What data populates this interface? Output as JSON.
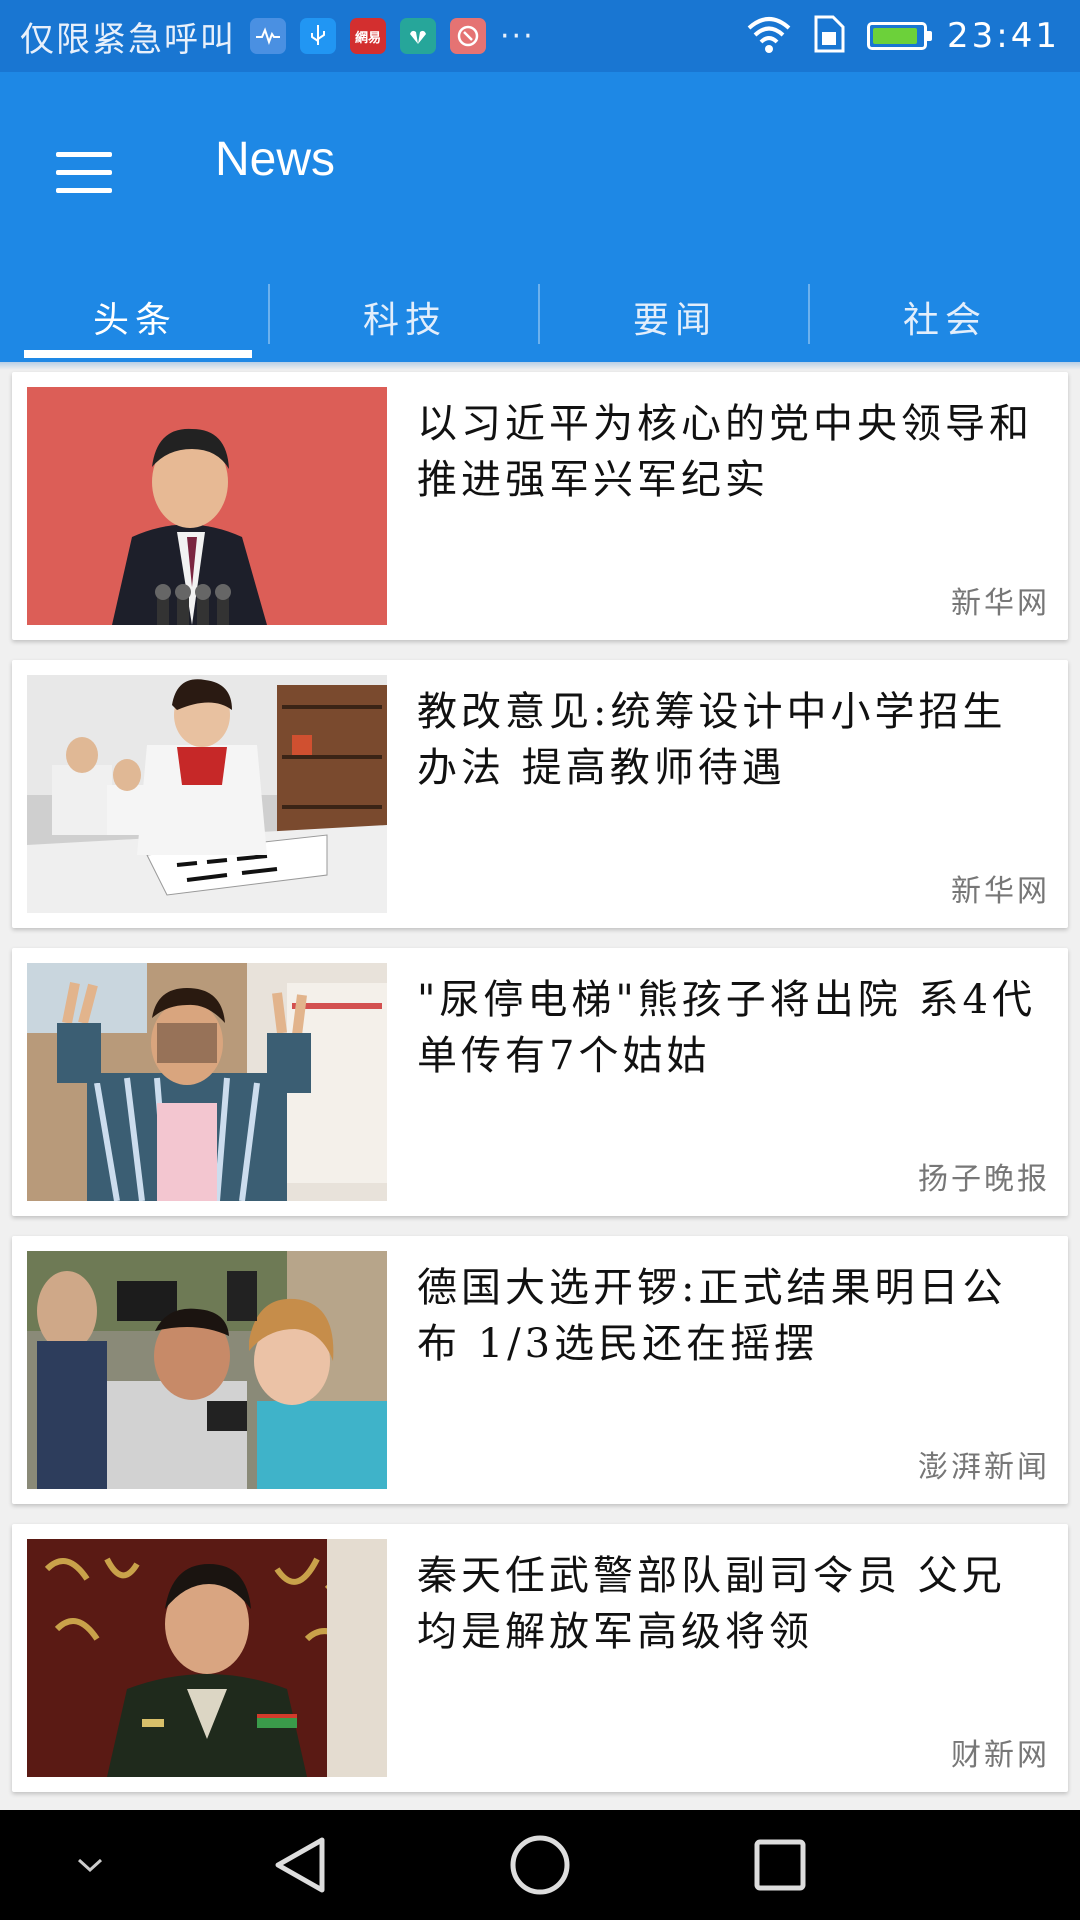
{
  "status_bar": {
    "carrier_text": "仅限紧急呼叫",
    "notification_icons": [
      "health-icon",
      "usb-icon",
      "netease-icon",
      "huawei-icon",
      "gesture-icon"
    ],
    "more": "···",
    "time": "23:41"
  },
  "app_bar": {
    "title": "News",
    "tabs": [
      {
        "label": "头条",
        "active": true
      },
      {
        "label": "科技",
        "active": false
      },
      {
        "label": "要闻",
        "active": false
      },
      {
        "label": "社会",
        "active": false
      }
    ]
  },
  "colors": {
    "status_bar": "#1976d2",
    "app_bar": "#1e88e5",
    "background": "#f0f0f0"
  },
  "articles": [
    {
      "headline": "以习近平为核心的党中央领导和推进强军兴军纪实",
      "source": "新华网",
      "thumbnail": "leader-speaking-photo"
    },
    {
      "headline": "教改意见:统筹设计中小学招生办法 提高教师待遇",
      "source": "新华网",
      "thumbnail": "students-calligraphy-photo"
    },
    {
      "headline": "\"尿停电梯\"熊孩子将出院 系4代单传有7个姑姑",
      "source": "扬子晚报",
      "thumbnail": "child-victory-sign-photo"
    },
    {
      "headline": "德国大选开锣:正式结果明日公布 1/3选民还在摇摆",
      "source": "澎湃新闻",
      "thumbnail": "merkel-selfie-photo"
    },
    {
      "headline": "秦天任武警部队副司令员 父兄均是解放军高级将领",
      "source": "财新网",
      "thumbnail": "officer-portrait-photo"
    }
  ],
  "nav_bar": [
    "collapse-icon",
    "back-icon",
    "home-icon",
    "recents-icon"
  ]
}
